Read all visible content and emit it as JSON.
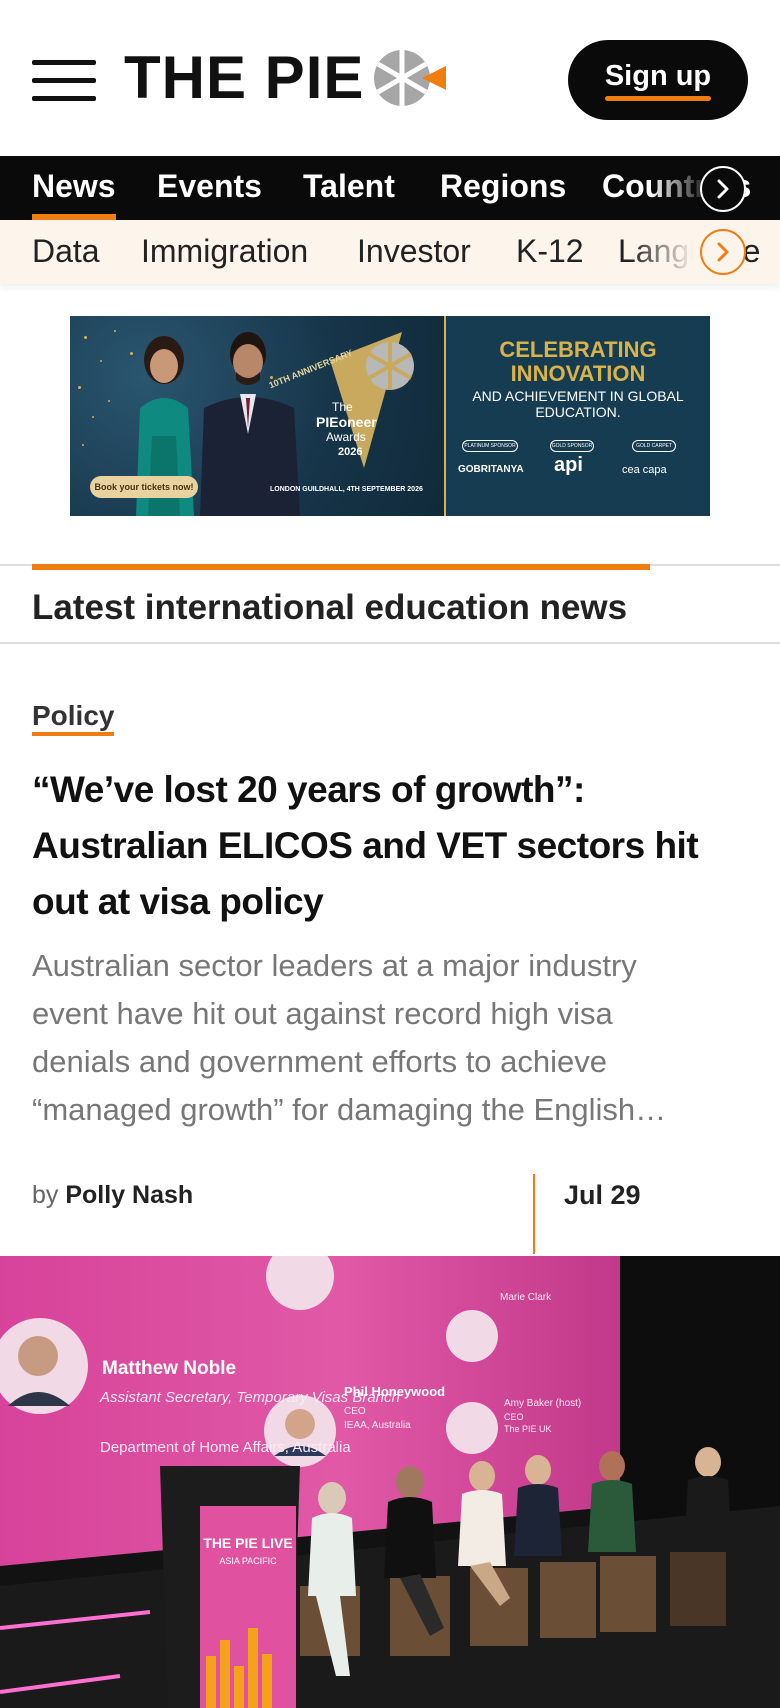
{
  "header": {
    "logo_text": "THE PIE",
    "signup_label": "Sign up"
  },
  "primary_nav": {
    "items": [
      {
        "label": "News",
        "active": true
      },
      {
        "label": "Events"
      },
      {
        "label": "Talent"
      },
      {
        "label": "Regions"
      },
      {
        "label": "Countries"
      }
    ]
  },
  "secondary_nav": {
    "items": [
      {
        "label": "Data"
      },
      {
        "label": "Immigration"
      },
      {
        "label": "Investor"
      },
      {
        "label": "K-12"
      },
      {
        "label": "Language"
      }
    ]
  },
  "banner": {
    "anniversary": "10TH ANNIVERSARY",
    "award_line1": "The",
    "award_line2": "PIEoneer",
    "award_line3": "Awards",
    "award_year": "2026",
    "venue": "LONDON GUILDHALL, 4TH SEPTEMBER 2026",
    "cta": "Book your tickets now!",
    "headline": "CELEBRATING INNOVATION",
    "subline": "AND ACHIEVEMENT IN GLOBAL EDUCATION.",
    "sponsors": [
      {
        "tier": "PLATINUM SPONSOR",
        "name": "GOBRITANYA"
      },
      {
        "tier": "GOLD SPONSOR",
        "name": "api"
      },
      {
        "tier": "GOLD CARPET",
        "name": "cea capa"
      }
    ]
  },
  "section": {
    "title": "Latest international education news"
  },
  "article": {
    "category": "Policy",
    "headline": "“We’ve lost 20 years of growth”: Australian ELICOS and VET sectors hit out at visa policy",
    "excerpt": "Australian sector leaders at a major industry event have hit out against record high visa denials and government efforts to achieve “managed growth” for damaging the English…",
    "byline_prefix": "by",
    "author": "Polly Nash",
    "date": "Jul 29"
  },
  "photo": {
    "screen_name": "Matthew Noble",
    "screen_title": "Assistant Secretary, Temporary Visas Branch",
    "screen_dept": "Department of Home Affairs, Australia",
    "speaker2_name": "Phil Honeywood",
    "speaker2_title": "CEO",
    "speaker2_org": "IEAA, Australia",
    "speaker3_name": "Marie Clark",
    "speaker4_name": "Amy Baker (host)",
    "speaker4_title": "CEO",
    "speaker4_org": "The PIE UK",
    "podium_brand": "THE PIE LIVE",
    "podium_sub": "ASIA PACIFIC",
    "colors": {
      "screen": "#e0519f",
      "stage": "#141414"
    }
  },
  "colors": {
    "accent": "#f07d10",
    "nav_bg": "#0a0a0a",
    "subnav_bg": "#fdf4ec"
  }
}
